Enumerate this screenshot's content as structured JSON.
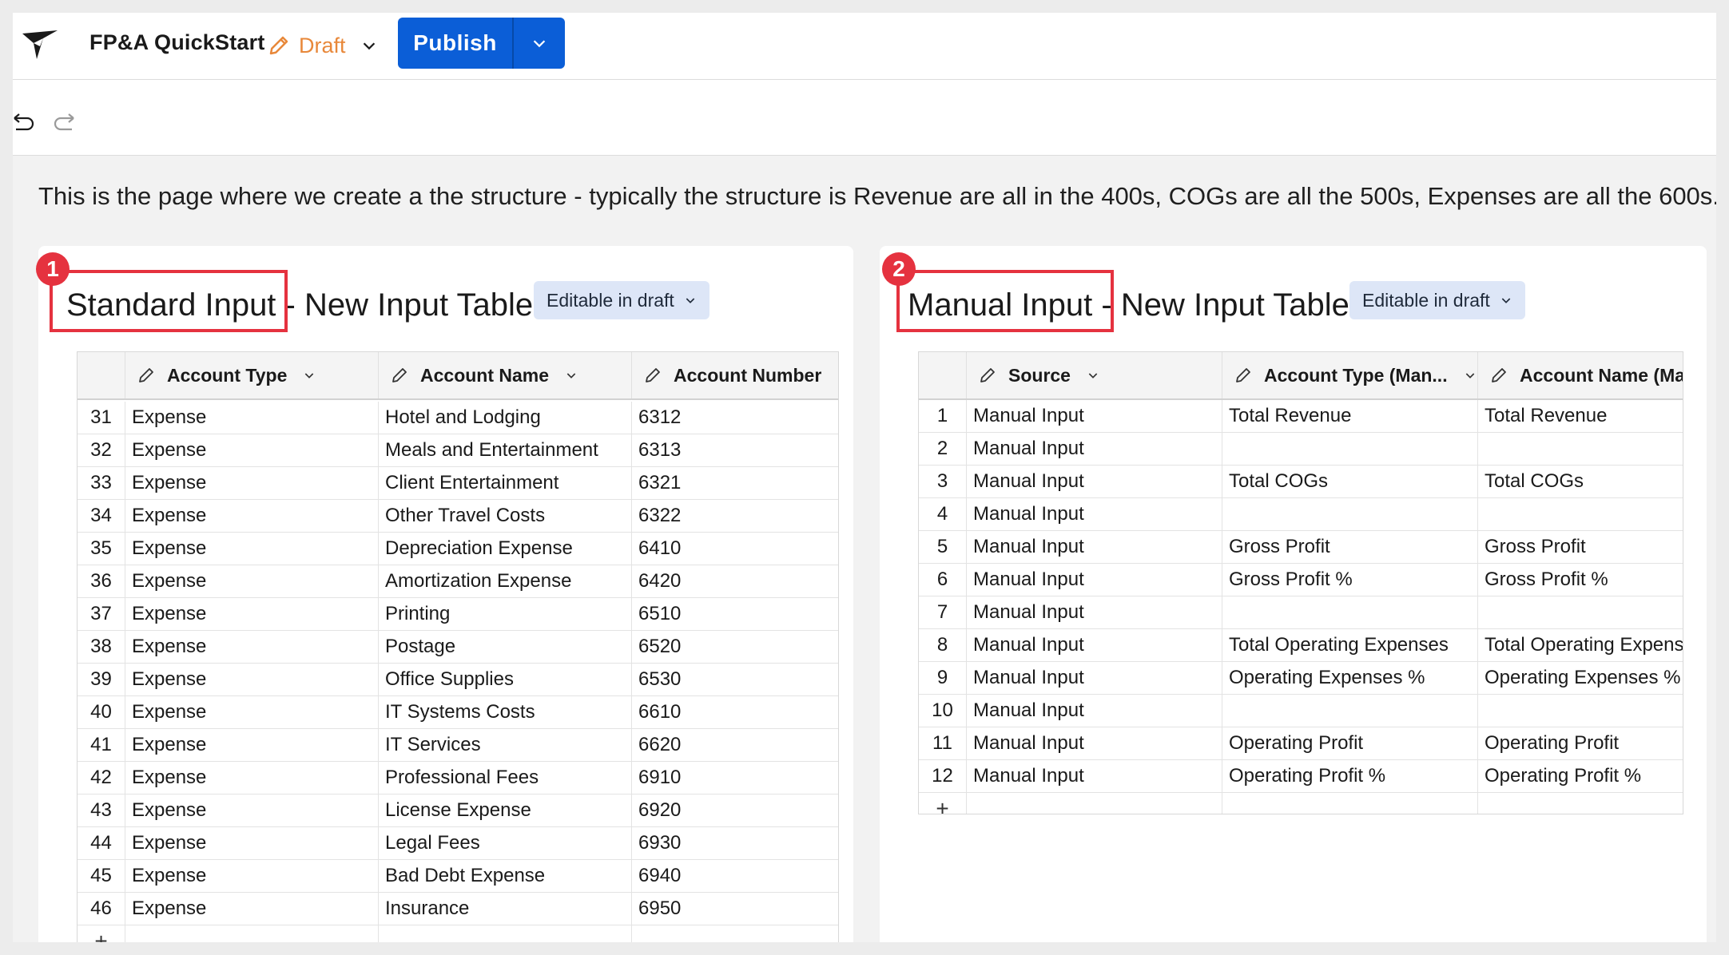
{
  "header": {
    "app_title": "FP&A QuickStart",
    "draft_label": "Draft",
    "publish_label": "Publish"
  },
  "description": "This is the page where we create a the structure - typically the structure is  Revenue are all in the 400s, COGs are all the 500s, Expenses are all the 600s.",
  "left_card": {
    "badge": "1",
    "title": "Standard Input - New Input Table",
    "status_pill": "Editable in draft",
    "columns": [
      "Account Type",
      "Account Name",
      "Account Number"
    ],
    "rows": [
      {
        "idx": "31",
        "type": "Expense",
        "name": "Hotel and Lodging",
        "number": "6312"
      },
      {
        "idx": "32",
        "type": "Expense",
        "name": "Meals and Entertainment",
        "number": "6313"
      },
      {
        "idx": "33",
        "type": "Expense",
        "name": "Client Entertainment",
        "number": "6321"
      },
      {
        "idx": "34",
        "type": "Expense",
        "name": "Other Travel Costs",
        "number": "6322"
      },
      {
        "idx": "35",
        "type": "Expense",
        "name": "Depreciation Expense",
        "number": "6410"
      },
      {
        "idx": "36",
        "type": "Expense",
        "name": "Amortization Expense",
        "number": "6420"
      },
      {
        "idx": "37",
        "type": "Expense",
        "name": "Printing",
        "number": "6510"
      },
      {
        "idx": "38",
        "type": "Expense",
        "name": "Postage",
        "number": "6520"
      },
      {
        "idx": "39",
        "type": "Expense",
        "name": "Office Supplies",
        "number": "6530"
      },
      {
        "idx": "40",
        "type": "Expense",
        "name": "IT Systems Costs",
        "number": "6610"
      },
      {
        "idx": "41",
        "type": "Expense",
        "name": "IT Services",
        "number": "6620"
      },
      {
        "idx": "42",
        "type": "Expense",
        "name": "Professional Fees",
        "number": "6910"
      },
      {
        "idx": "43",
        "type": "Expense",
        "name": "License Expense",
        "number": "6920"
      },
      {
        "idx": "44",
        "type": "Expense",
        "name": "Legal Fees",
        "number": "6930"
      },
      {
        "idx": "45",
        "type": "Expense",
        "name": "Bad Debt Expense",
        "number": "6940"
      },
      {
        "idx": "46",
        "type": "Expense",
        "name": "Insurance",
        "number": "6950"
      }
    ],
    "add_row": "+"
  },
  "right_card": {
    "badge": "2",
    "title": "Manual Input - New Input Table",
    "status_pill": "Editable in draft",
    "columns": [
      "Source",
      "Account Type (Man...",
      "Account Name (Ma..."
    ],
    "rows": [
      {
        "idx": "1",
        "source": "Manual Input",
        "type": "Total Revenue",
        "name": "Total Revenue"
      },
      {
        "idx": "2",
        "source": "Manual Input",
        "type": "",
        "name": ""
      },
      {
        "idx": "3",
        "source": "Manual Input",
        "type": "Total COGs",
        "name": "Total COGs"
      },
      {
        "idx": "4",
        "source": "Manual Input",
        "type": "",
        "name": ""
      },
      {
        "idx": "5",
        "source": "Manual Input",
        "type": "Gross Profit",
        "name": "Gross Profit"
      },
      {
        "idx": "6",
        "source": "Manual Input",
        "type": "Gross Profit %",
        "name": "Gross Profit %"
      },
      {
        "idx": "7",
        "source": "Manual Input",
        "type": "",
        "name": ""
      },
      {
        "idx": "8",
        "source": "Manual Input",
        "type": "Total Operating Expenses",
        "name": "Total Operating Expens"
      },
      {
        "idx": "9",
        "source": "Manual Input",
        "type": "Operating Expenses %",
        "name": "Operating Expenses %"
      },
      {
        "idx": "10",
        "source": "Manual Input",
        "type": "",
        "name": ""
      },
      {
        "idx": "11",
        "source": "Manual Input",
        "type": "Operating Profit",
        "name": "Operating Profit"
      },
      {
        "idx": "12",
        "source": "Manual Input",
        "type": "Operating Profit %",
        "name": "Operating Profit %"
      }
    ],
    "add_row": "+"
  },
  "colors": {
    "accent_blue": "#0b5ed7",
    "draft_orange": "#e8883a",
    "highlight_red": "#e5323f",
    "pill_bg": "#dde6f7"
  }
}
